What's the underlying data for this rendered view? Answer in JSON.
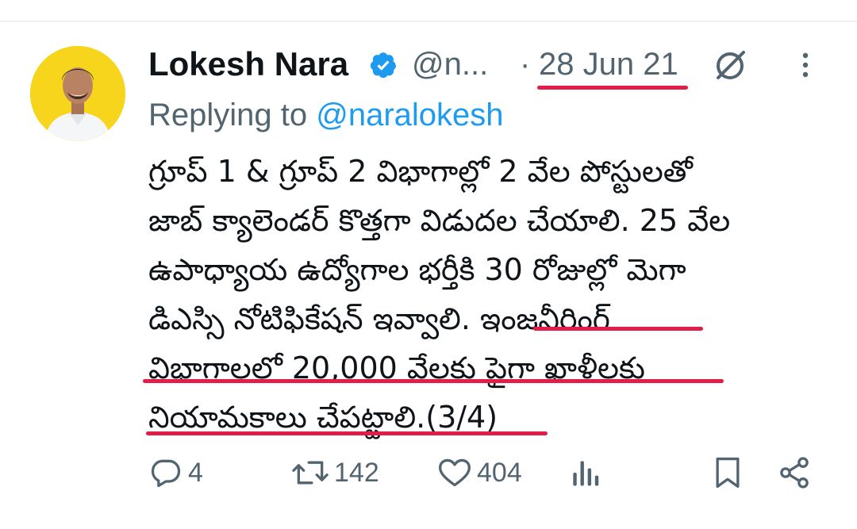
{
  "tweet": {
    "author": {
      "display_name": "Lokesh Nara",
      "handle": "@n...",
      "verified": true,
      "avatar_bg": "#f7d51d"
    },
    "separator": "·",
    "timestamp": "28 Jun 21",
    "reply_prefix": "Replying to",
    "reply_to": "@naralokesh",
    "text_lines": [
      "గ్రూప్ 1 & గ్రూప్ 2 విభాగాల్లో 2 వేల పోస్టులతో",
      "జాబ్ క్యాలెండర్ కొత్తగా విడుదల చేయాలి. 25 వేల",
      "ఉపాధ్యాయ ఉద్యోగాల భర్తీకి 30 రోజుల్లో మెగా",
      "డిఎస్సి నోటిఫికేషన్ ఇవ్వాలి. ఇంజనీరింగ్",
      "విభాగాలలో 20,000 వేలకు పైగా ఖాళీలకు",
      "నియామకాలు చేపట్టాలి.(3/4)"
    ]
  },
  "actions": {
    "reply_count": "4",
    "retweet_count": "142",
    "like_count": "404"
  },
  "icons": {
    "verified": "verified-badge-icon",
    "grok": "grok-icon",
    "more": "more-vertical-icon",
    "reply": "reply-icon",
    "retweet": "retweet-icon",
    "like": "heart-icon",
    "views": "views-icon",
    "bookmark": "bookmark-icon",
    "share": "share-icon"
  },
  "colors": {
    "text": "#0f1419",
    "secondary": "#536471",
    "link": "#1d9bf0",
    "verified": "#1d9bf0",
    "annotation": "#e11d48"
  }
}
